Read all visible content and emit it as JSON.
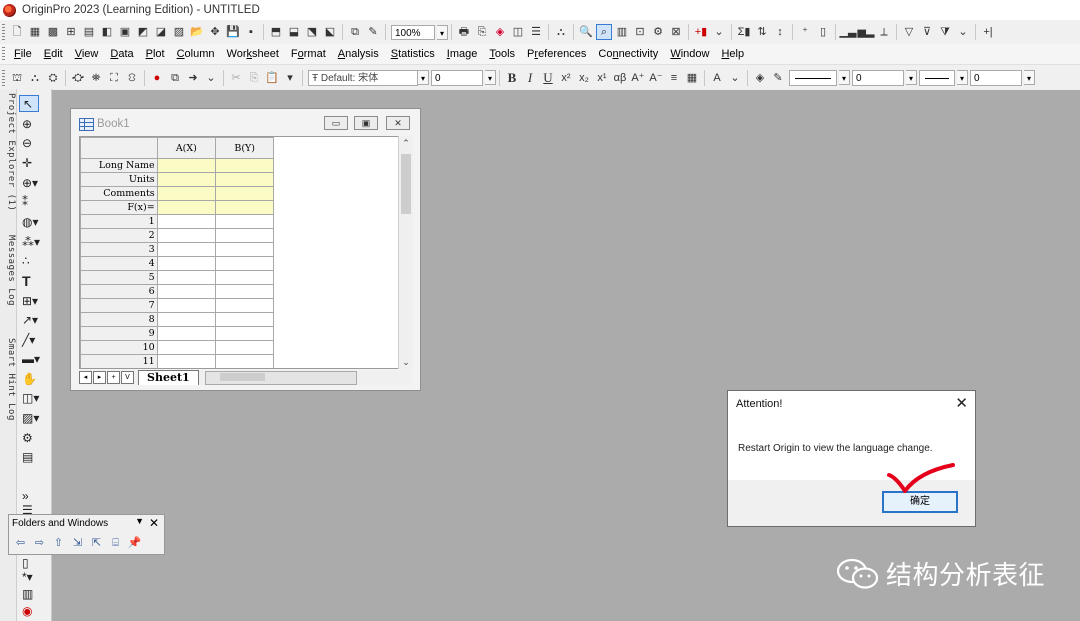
{
  "window": {
    "title": "OriginPro 2023 (Learning Edition) - UNTITLED"
  },
  "toolbar1": {
    "zoom": "100%",
    "buttons": [
      "new-project",
      "new-workbook",
      "new-matrix",
      "new-graph",
      "new-function",
      "new-layout",
      "new-notes",
      "open",
      "open-template",
      "save-project",
      "save-template",
      "import-ascii",
      "import-multiple",
      "import-wizard",
      "import-excel",
      "add-new-columns",
      "print",
      "duplicate",
      "refresh",
      "recalculate",
      "zoom-in",
      "zoom-out",
      "project-explorer",
      "results-log",
      "script-window",
      "command-window",
      "code-builder",
      "add-column",
      "statistics-on-rows",
      "sort",
      "set-xy",
      "plot-line",
      "plot-scatter",
      "plot-line-symbol",
      "filter",
      "remove-filter",
      "merge"
    ]
  },
  "menu": {
    "items": [
      {
        "label": "File",
        "hotkey": "F"
      },
      {
        "label": "Edit",
        "hotkey": "E"
      },
      {
        "label": "View",
        "hotkey": "V"
      },
      {
        "label": "Data",
        "hotkey": "D"
      },
      {
        "label": "Plot",
        "hotkey": "P"
      },
      {
        "label": "Column",
        "hotkey": "C"
      },
      {
        "label": "Worksheet",
        "hotkey": "k"
      },
      {
        "label": "Format",
        "hotkey": "o"
      },
      {
        "label": "Analysis",
        "hotkey": "A"
      },
      {
        "label": "Statistics",
        "hotkey": "S"
      },
      {
        "label": "Image",
        "hotkey": "I"
      },
      {
        "label": "Tools",
        "hotkey": "T"
      },
      {
        "label": "Preferences",
        "hotkey": "r"
      },
      {
        "label": "Connectivity",
        "hotkey": "n"
      },
      {
        "label": "Window",
        "hotkey": "W"
      },
      {
        "label": "Help",
        "hotkey": "H"
      }
    ]
  },
  "toolbar2": {
    "font": "Default: 宋体",
    "font_size": "0",
    "line_width": "0",
    "pattern": "0"
  },
  "left_tabs": {
    "project_explorer": "Project Explorer (1)",
    "messages_log": "Messages Log",
    "smart_hint_log": "Smart Hint Log"
  },
  "book": {
    "name": "Book1",
    "columns": [
      "A(X)",
      "B(Y)"
    ],
    "meta_rows": [
      "Long Name",
      "Units",
      "Comments",
      "F(x)="
    ],
    "row_numbers": [
      "1",
      "2",
      "3",
      "4",
      "5",
      "6",
      "7",
      "8",
      "9",
      "10",
      "11"
    ],
    "sheet_tab": "Sheet1",
    "nav_buttons": [
      "◂",
      "▸",
      "+",
      "V"
    ]
  },
  "folders_panel": {
    "title": "Folders and Windows"
  },
  "dialog": {
    "title": "Attention!",
    "message": "Restart Origin to view the language change.",
    "ok_label": "确定"
  },
  "watermark": {
    "text": "结构分析表征"
  },
  "colors": {
    "workspace": "#ababab",
    "meta_row": "#fbfbc6",
    "ok_border": "#2b73c9",
    "annotation": "#e4001b"
  }
}
